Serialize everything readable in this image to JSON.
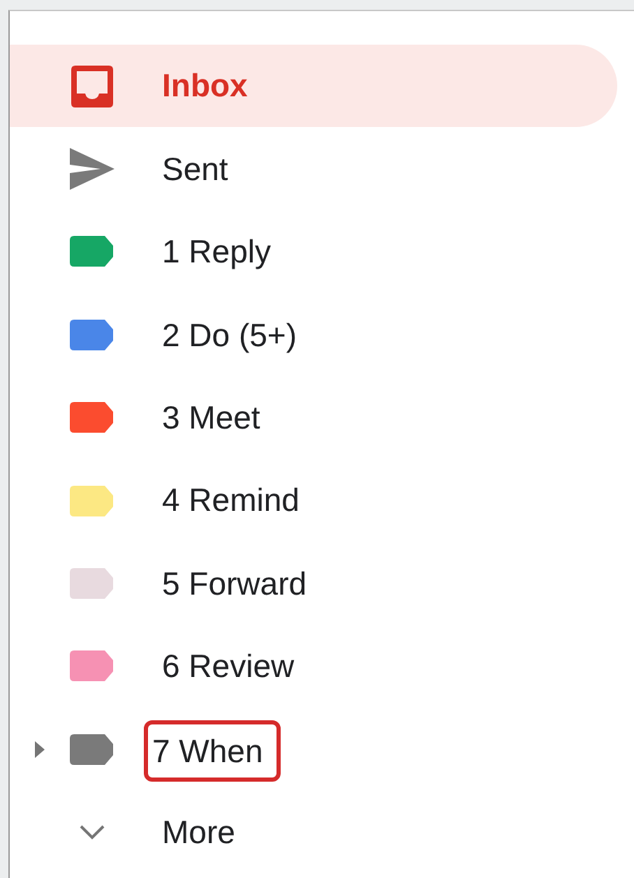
{
  "nav_items": [
    {
      "kind": "inbox",
      "label": "Inbox",
      "selected": true,
      "expandable": false,
      "highlighted": false
    },
    {
      "kind": "sent",
      "label": "Sent",
      "selected": false,
      "expandable": false,
      "highlighted": false
    },
    {
      "kind": "label",
      "label": "1 Reply",
      "color": "#16a765",
      "selected": false,
      "expandable": false,
      "highlighted": false
    },
    {
      "kind": "label",
      "label": "2 Do (5+)",
      "color": "#4a86e8",
      "selected": false,
      "expandable": false,
      "highlighted": false
    },
    {
      "kind": "label",
      "label": "3 Meet",
      "color": "#fb4c2f",
      "selected": false,
      "expandable": false,
      "highlighted": false
    },
    {
      "kind": "label",
      "label": "4 Remind",
      "color": "#fce883",
      "selected": false,
      "expandable": false,
      "highlighted": false
    },
    {
      "kind": "label",
      "label": "5 Forward",
      "color": "#e8dadf",
      "selected": false,
      "expandable": false,
      "highlighted": false
    },
    {
      "kind": "label",
      "label": "6 Review",
      "color": "#f691b3",
      "selected": false,
      "expandable": false,
      "highlighted": false
    },
    {
      "kind": "label",
      "label": "7 When",
      "color": "#7a7a7a",
      "selected": false,
      "expandable": true,
      "highlighted": true
    },
    {
      "kind": "more",
      "label": "More",
      "selected": false,
      "expandable": false,
      "highlighted": false
    }
  ]
}
